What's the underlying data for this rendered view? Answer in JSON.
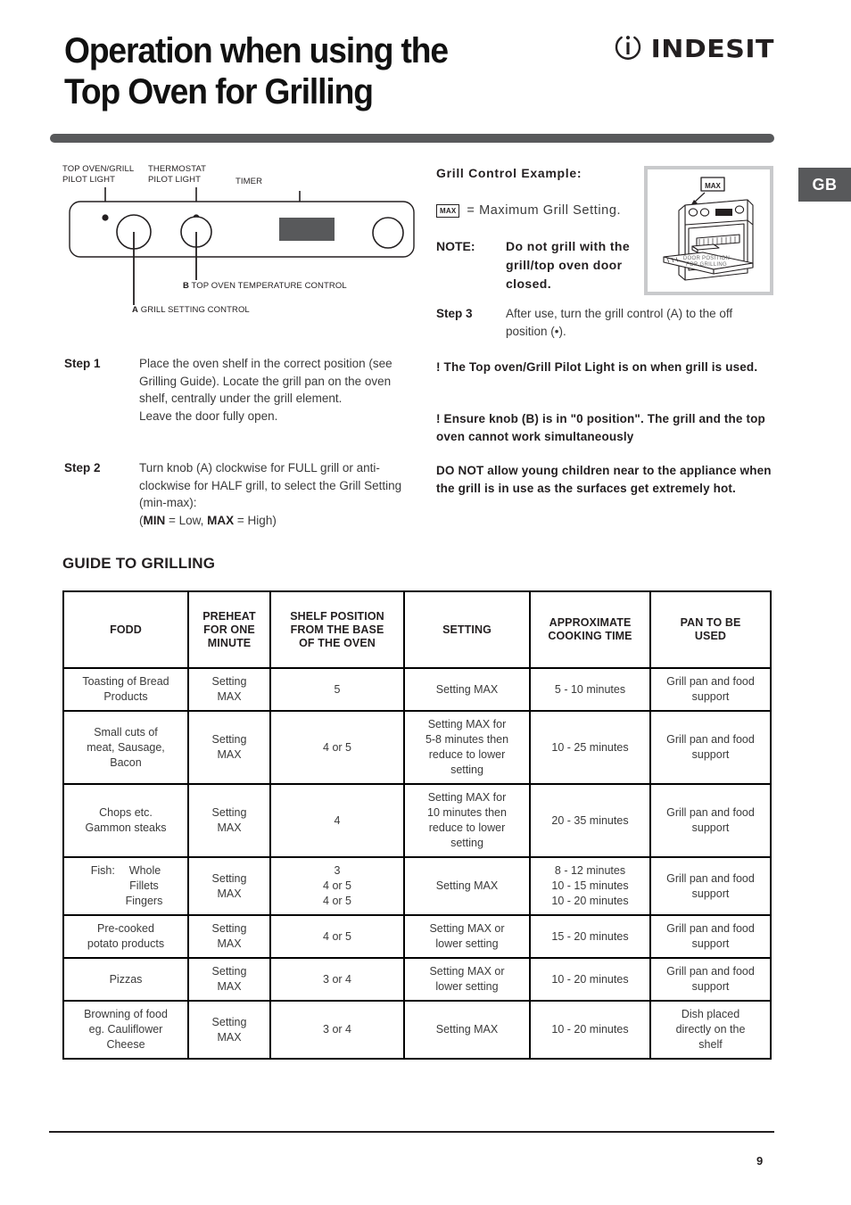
{
  "header": {
    "title_line1": "Operation when using the",
    "title_line2": "Top Oven for Grilling",
    "brand": "INDESIT",
    "logo_icon": "indesit-i-circle-icon"
  },
  "region_tab": {
    "label": "GB"
  },
  "control_panel": {
    "label_pilot_light": "TOP OVEN/GRILL\nPILOT LIGHT",
    "label_thermostat": "THERMOSTAT\nPILOT LIGHT",
    "label_timer": "TIMER",
    "callout_b_letter": "B",
    "callout_b_text": "TOP OVEN TEMPERATURE CONTROL",
    "callout_a_letter": "A",
    "callout_a_text": "GRILL SETTING CONTROL"
  },
  "steps": {
    "step1_label": "Step 1",
    "step1_text": "Place the oven shelf in the correct position (see Grilling Guide). Locate the grill pan on the oven shelf, centrally under the grill element.\nLeave the door fully open.",
    "step2_label": "Step 2",
    "step2_text_a": "Turn knob (A) clockwise for FULL grill or anti-clockwise for HALF grill, to select the Grill Setting (min-max):",
    "step2_min": "MIN",
    "step2_min_val": " = Low, ",
    "step2_max": "MAX",
    "step2_max_val": " = High)",
    "step2_open_paren": "(",
    "step3_label": "Step 3",
    "step3_text": "After use, turn the grill control (A) to the off position (•)."
  },
  "grill_example": {
    "heading": "Grill Control Example:",
    "max_chip": "MAX",
    "max_definition": "= Maximum Grill Setting.",
    "note_label": "NOTE:",
    "note_text": "Do not grill with the grill/top oven door closed."
  },
  "oven_illustration": {
    "max_callout": "MAX",
    "door_caption_line1": "DOOR POSITION",
    "door_caption_line2": "FOR GRILLING"
  },
  "warnings": {
    "warning1": "! The Top oven/Grill Pilot Light is on when grill is used.",
    "warning2": "! Ensure knob (B) is in \"0 position\". The grill and the top oven cannot work simultaneously",
    "warning3_bold": "DO NOT",
    "warning3_rest": " allow young children near to the appliance when the grill is in use as the surfaces get extremely hot."
  },
  "guide": {
    "heading": "GUIDE TO GRILLING",
    "columns": [
      "FODD",
      "PREHEAT\nFOR ONE\nMINUTE",
      "SHELF POSITION\nFROM THE BASE\nOF THE OVEN",
      "SETTING",
      "APPROXIMATE\nCOOKING TIME",
      "PAN TO BE\nUSED"
    ],
    "rows": [
      {
        "food": "Toasting of Bread\nProducts",
        "preheat": "Setting\nMAX",
        "shelf": "5",
        "setting": "Setting MAX",
        "time": "5 - 10 minutes",
        "pan": "Grill pan and food\nsupport"
      },
      {
        "food": "Small cuts of\nmeat, Sausage,\nBacon",
        "preheat": "Setting\nMAX",
        "shelf": "4 or 5",
        "setting": "Setting MAX for\n5-8 minutes then\nreduce to lower\nsetting",
        "time": "10 - 25 minutes",
        "pan": "Grill pan and food\nsupport"
      },
      {
        "food": "Chops etc.\nGammon steaks",
        "preheat": "Setting\nMAX",
        "shelf": "4",
        "setting": "Setting MAX for\n10 minutes then\nreduce to lower\nsetting",
        "time": "20 - 35 minutes",
        "pan": "Grill pan and food\nsupport"
      },
      {
        "food": "Fish:  Whole\n    Fillets\n    Fingers",
        "preheat": "Setting\nMAX",
        "shelf": "3\n4 or 5\n4 or 5",
        "setting": "Setting MAX",
        "time": "8 - 12 minutes\n10 - 15 minutes\n10 - 20 minutes",
        "pan": "Grill pan and food\nsupport"
      },
      {
        "food": "Pre-cooked\npotato products",
        "preheat": "Setting\nMAX",
        "shelf": "4 or 5",
        "setting": "Setting MAX or\nlower setting",
        "time": "15 - 20 minutes",
        "pan": "Grill pan and food\nsupport"
      },
      {
        "food": "Pizzas",
        "preheat": "Setting\nMAX",
        "shelf": "3 or 4",
        "setting": "Setting MAX or\nlower setting",
        "time": "10 - 20 minutes",
        "pan": "Grill pan and food\nsupport"
      },
      {
        "food": "Browning of food\neg. Cauliflower\nCheese",
        "preheat": "Setting\nMAX",
        "shelf": "3 or 4",
        "setting": "Setting MAX",
        "time": "10 - 20 minutes",
        "pan": "Dish placed\ndirectly on the\nshelf"
      }
    ]
  },
  "footer": {
    "page_number": "9"
  },
  "colors": {
    "rule_gray": "#58595b",
    "text": "#231f20",
    "body_text": "#3a3a3a",
    "illustration_border": "#c9cacc"
  }
}
